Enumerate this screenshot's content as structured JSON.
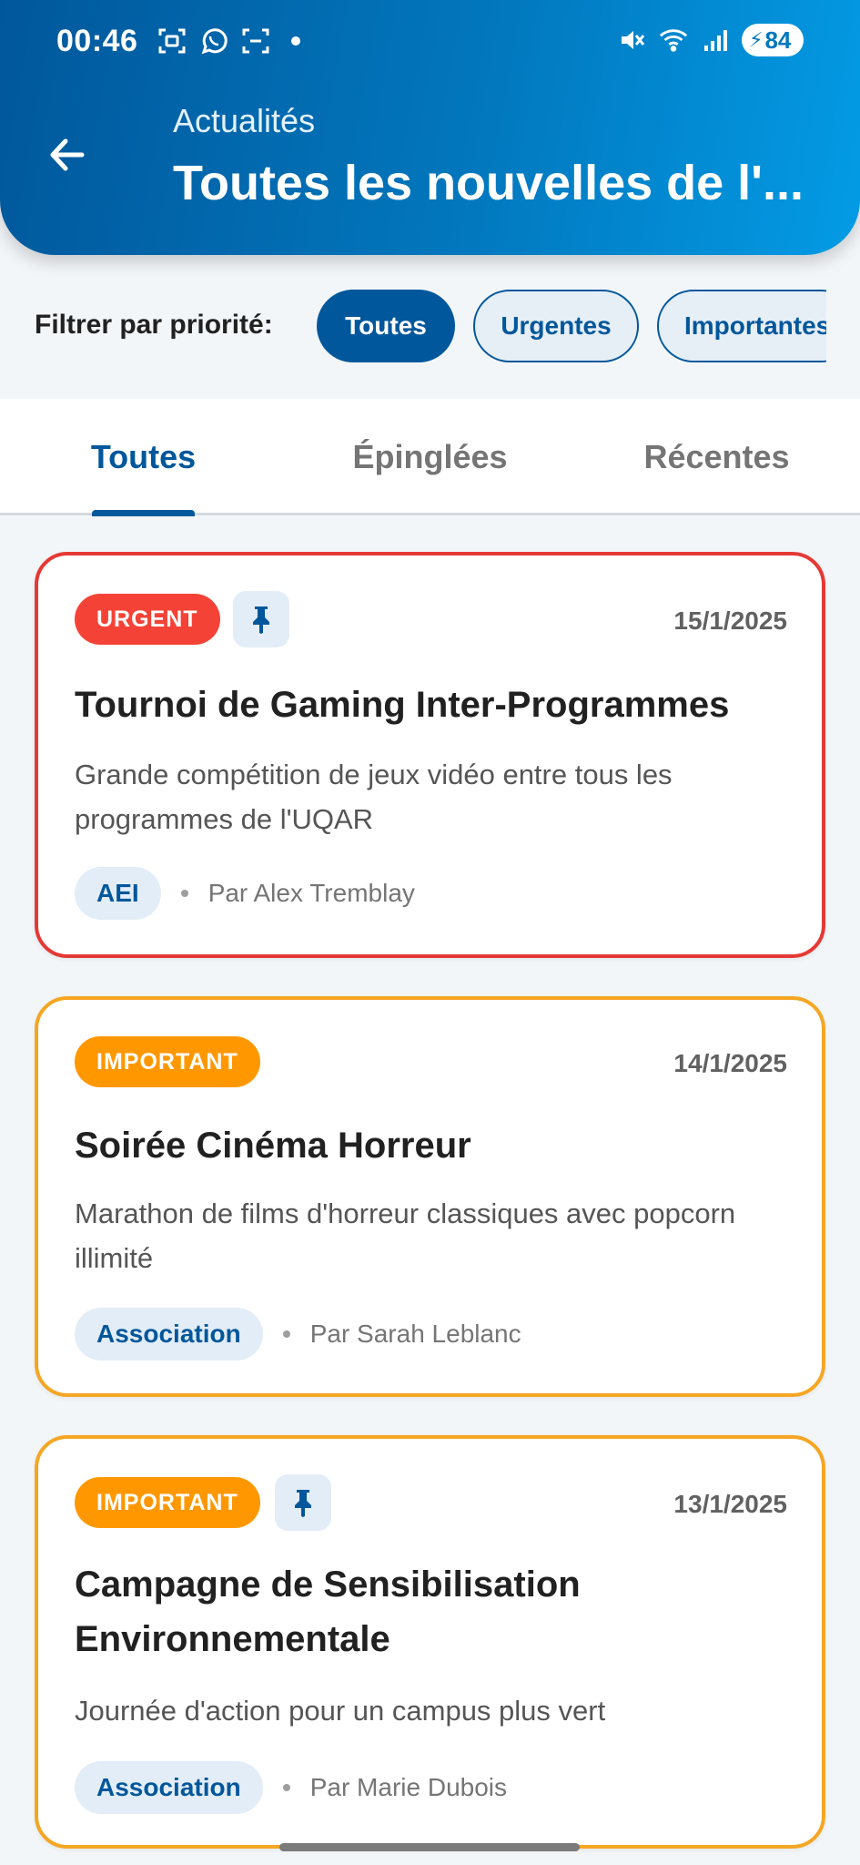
{
  "status_bar": {
    "time": "00:46",
    "battery": "84"
  },
  "header": {
    "subtitle": "Actualités",
    "title": "Toutes les nouvelles de l'..."
  },
  "filter": {
    "label": "Filtrer par priorité:",
    "chips": [
      "Toutes",
      "Urgentes",
      "Importantes"
    ],
    "selected": "Toutes"
  },
  "tabs": [
    {
      "label": "Toutes",
      "active": true
    },
    {
      "label": "Épinglées",
      "active": false
    },
    {
      "label": "Récentes",
      "active": false
    }
  ],
  "news": [
    {
      "priority": "URGENT",
      "pinned": true,
      "date": "15/1/2025",
      "title": "Tournoi de Gaming Inter-Programmes",
      "description": "Grande compétition de jeux vidéo entre tous les programmes de l'UQAR",
      "tag": "AEI",
      "author": "Par Alex Tremblay"
    },
    {
      "priority": "IMPORTANT",
      "pinned": false,
      "date": "14/1/2025",
      "title": "Soirée Cinéma Horreur",
      "description": "Marathon de films d'horreur classiques avec popcorn illimité",
      "tag": "Association",
      "author": "Par Sarah Leblanc"
    },
    {
      "priority": "IMPORTANT",
      "pinned": true,
      "date": "13/1/2025",
      "title": "Campagne de Sensibilisation Environnementale",
      "description": "Journée d'action pour un campus plus vert",
      "tag": "Association",
      "author": "Par Marie Dubois"
    }
  ],
  "colors": {
    "primary": "#01579b",
    "urgent": "#f44336",
    "important": "#ff9800"
  }
}
